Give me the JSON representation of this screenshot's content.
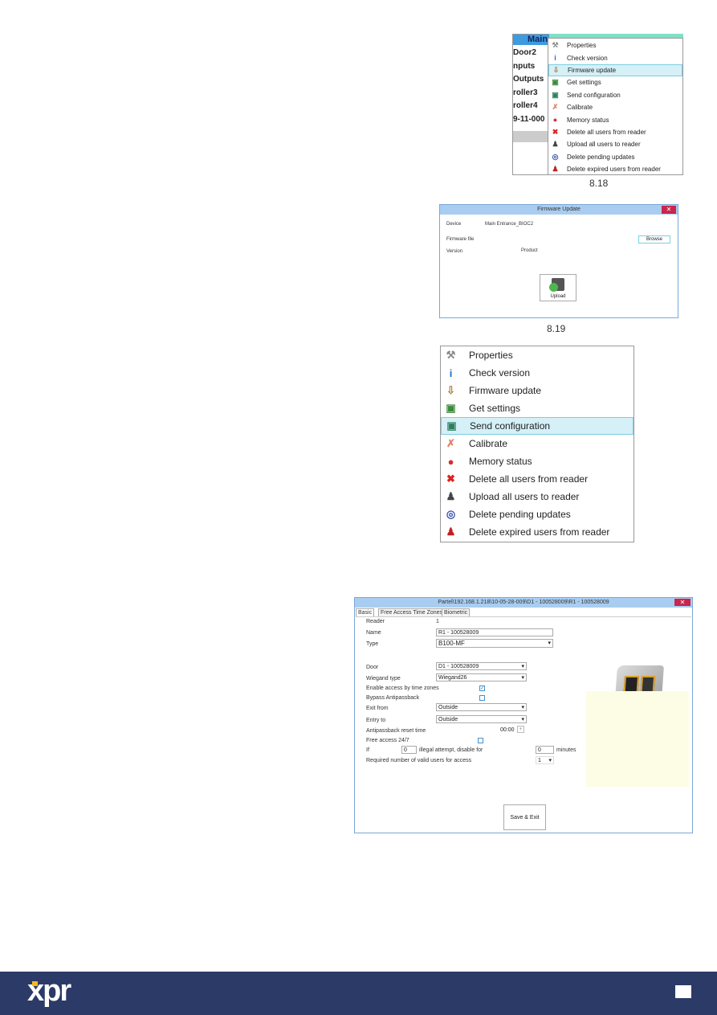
{
  "menu_small": {
    "tree_header": "Main",
    "tree_labels": [
      "Door2",
      "nputs",
      "Outputs",
      "roller3",
      "roller4",
      "9-11-000"
    ],
    "items": [
      {
        "label": "Properties",
        "icon": "tools-icon"
      },
      {
        "label": "Check version",
        "icon": "info-icon"
      },
      {
        "label": "Firmware update",
        "icon": "firmware-icon",
        "highlighted": true
      },
      {
        "label": "Get settings",
        "icon": "get-settings-icon"
      },
      {
        "label": "Send configuration",
        "icon": "send-config-icon"
      },
      {
        "label": "Calibrate",
        "icon": "calibrate-icon"
      },
      {
        "label": "Memory status",
        "icon": "memory-icon"
      },
      {
        "label": "Delete all users from reader",
        "icon": "delete-x-icon"
      },
      {
        "label": "Upload all users to reader",
        "icon": "upload-users-icon"
      },
      {
        "label": "Delete pending updates",
        "icon": "delete-pending-icon"
      },
      {
        "label": "Delete expired users from reader",
        "icon": "delete-expired-icon"
      }
    ],
    "caption": "8.18"
  },
  "firmware_dialog": {
    "title": "Firmware Update",
    "device_label": "Device",
    "device_value": "Main Entrance_BIOC2",
    "file_label": "Firmware file",
    "browse": "Browse",
    "version_label": "Version",
    "product": "Product",
    "upload": "Upload",
    "caption": "8.19"
  },
  "menu_large": {
    "items": [
      {
        "label": "Properties",
        "icon": "tools-icon"
      },
      {
        "label": "Check version",
        "icon": "info-icon"
      },
      {
        "label": "Firmware update",
        "icon": "firmware-icon"
      },
      {
        "label": "Get settings",
        "icon": "get-settings-icon"
      },
      {
        "label": "Send configuration",
        "icon": "send-config-icon",
        "highlighted": true
      },
      {
        "label": "Calibrate",
        "icon": "calibrate-icon"
      },
      {
        "label": "Memory status",
        "icon": "memory-icon"
      },
      {
        "label": "Delete all users from reader",
        "icon": "delete-x-icon"
      },
      {
        "label": "Upload all users to reader",
        "icon": "upload-users-icon"
      },
      {
        "label": "Delete pending updates",
        "icon": "delete-pending-icon"
      },
      {
        "label": "Delete expired users from reader",
        "icon": "delete-expired-icon"
      }
    ]
  },
  "reader_dialog": {
    "title": "Partel\\192.168.1.218\\10-05-28-009\\D1 - 100528009\\R1 - 100528009",
    "tabs": [
      "Basic",
      "Free Access Time Zones",
      "Biometric"
    ],
    "reader_label": "Reader",
    "reader_value": "1",
    "name_label": "Name",
    "name_value": "R1 - 100528009",
    "type_label": "Type",
    "type_value": "B100-MF",
    "door_label": "Door",
    "door_value": "D1 - 100528009",
    "wiegand_label": "Wiegand type",
    "wiegand_value": "Wiegand26",
    "time_zones_label": "Enable access by time zones",
    "time_zones_checked": true,
    "bypass_label": "Bypass Antipassback",
    "bypass_checked": false,
    "exit_label": "Exit from",
    "exit_value": "Outside",
    "entry_label": "Entry to",
    "entry_value": "Outside",
    "reset_label": "Antipassback reset time",
    "reset_value": "00:00",
    "free_label": "Free access 24/7",
    "free_checked": false,
    "if_label": "If",
    "attempts_value": "0",
    "illegal_label": "illegal attempt, disable for",
    "minutes_value": "0",
    "minutes_label": "minutes",
    "required_label": "Required number of valid users for access",
    "required_value": "1",
    "save": "Save & Exit"
  },
  "footer": {
    "logo": "xpr",
    "bg": "#2b3a67"
  }
}
